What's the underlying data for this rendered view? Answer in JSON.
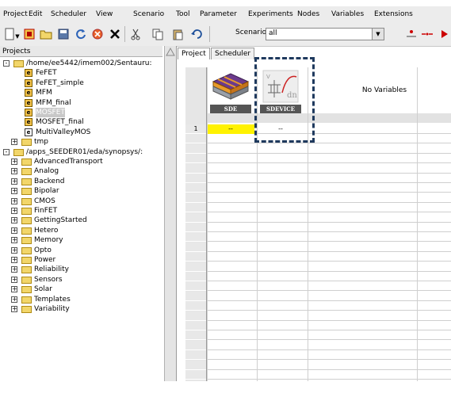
{
  "menu": {
    "items": [
      "Project",
      "Edit",
      "Scheduler",
      "View",
      "Scenario",
      "Tool",
      "Parameter",
      "Experiments",
      "Nodes",
      "Variables",
      "Extensions"
    ]
  },
  "toolbar": {
    "scenario_label": "Scenario:",
    "scenario_value": "all",
    "icons": [
      "new-icon",
      "open-icon",
      "folder-icon",
      "save-icon",
      "refresh-icon",
      "stop-icon",
      "close-x-icon",
      "cut-icon",
      "copy-icon",
      "paste-icon",
      "undo-icon"
    ]
  },
  "projects_panel": {
    "header": "Projects",
    "tree": [
      {
        "label": "/home/ee5442/imem002/Sentauru:",
        "type": "folder",
        "level": 0
      },
      {
        "label": "FeFET",
        "type": "project",
        "level": 1
      },
      {
        "label": "FeFET_simple",
        "type": "project",
        "level": 1
      },
      {
        "label": "MFM",
        "type": "project",
        "level": 1
      },
      {
        "label": "MFM_final",
        "type": "project",
        "level": 1
      },
      {
        "label": "MOSFET",
        "type": "project",
        "level": 1,
        "selected": true
      },
      {
        "label": "MOSFET_final",
        "type": "project",
        "level": 1
      },
      {
        "label": "MultiValleyMOS",
        "type": "project-white",
        "level": 1
      },
      {
        "label": "tmp",
        "type": "folder",
        "level": 1
      },
      {
        "label": "/apps_SEEDER01/eda/synopsys/:",
        "type": "folder",
        "level": 0
      },
      {
        "label": "AdvancedTransport",
        "type": "folder",
        "level": 1
      },
      {
        "label": "Analog",
        "type": "folder",
        "level": 1
      },
      {
        "label": "Backend",
        "type": "folder",
        "level": 1
      },
      {
        "label": "Bipolar",
        "type": "folder",
        "level": 1
      },
      {
        "label": "CMOS",
        "type": "folder",
        "level": 1
      },
      {
        "label": "FinFET",
        "type": "folder",
        "level": 1
      },
      {
        "label": "GettingStarted",
        "type": "folder",
        "level": 1
      },
      {
        "label": "Hetero",
        "type": "folder",
        "level": 1
      },
      {
        "label": "Memory",
        "type": "folder",
        "level": 1
      },
      {
        "label": "Opto",
        "type": "folder",
        "level": 1
      },
      {
        "label": "Power",
        "type": "folder",
        "level": 1
      },
      {
        "label": "Reliability",
        "type": "folder",
        "level": 1
      },
      {
        "label": "Sensors",
        "type": "folder",
        "level": 1
      },
      {
        "label": "Solar",
        "type": "folder",
        "level": 1
      },
      {
        "label": "Templates",
        "type": "folder",
        "level": 1
      },
      {
        "label": "Variability",
        "type": "folder",
        "level": 1
      }
    ]
  },
  "tabs": [
    {
      "label": "Project",
      "active": true
    },
    {
      "label": "Scheduler",
      "active": false
    }
  ],
  "grid": {
    "tools": [
      {
        "label": "SDE"
      },
      {
        "label": "SDEVICE"
      }
    ],
    "no_variables": "No Variables",
    "rows": [
      {
        "num": "1",
        "cells": [
          "--",
          "--"
        ]
      }
    ],
    "highlight_color": "#fff200",
    "annotation_color": "#1f3a5e"
  }
}
